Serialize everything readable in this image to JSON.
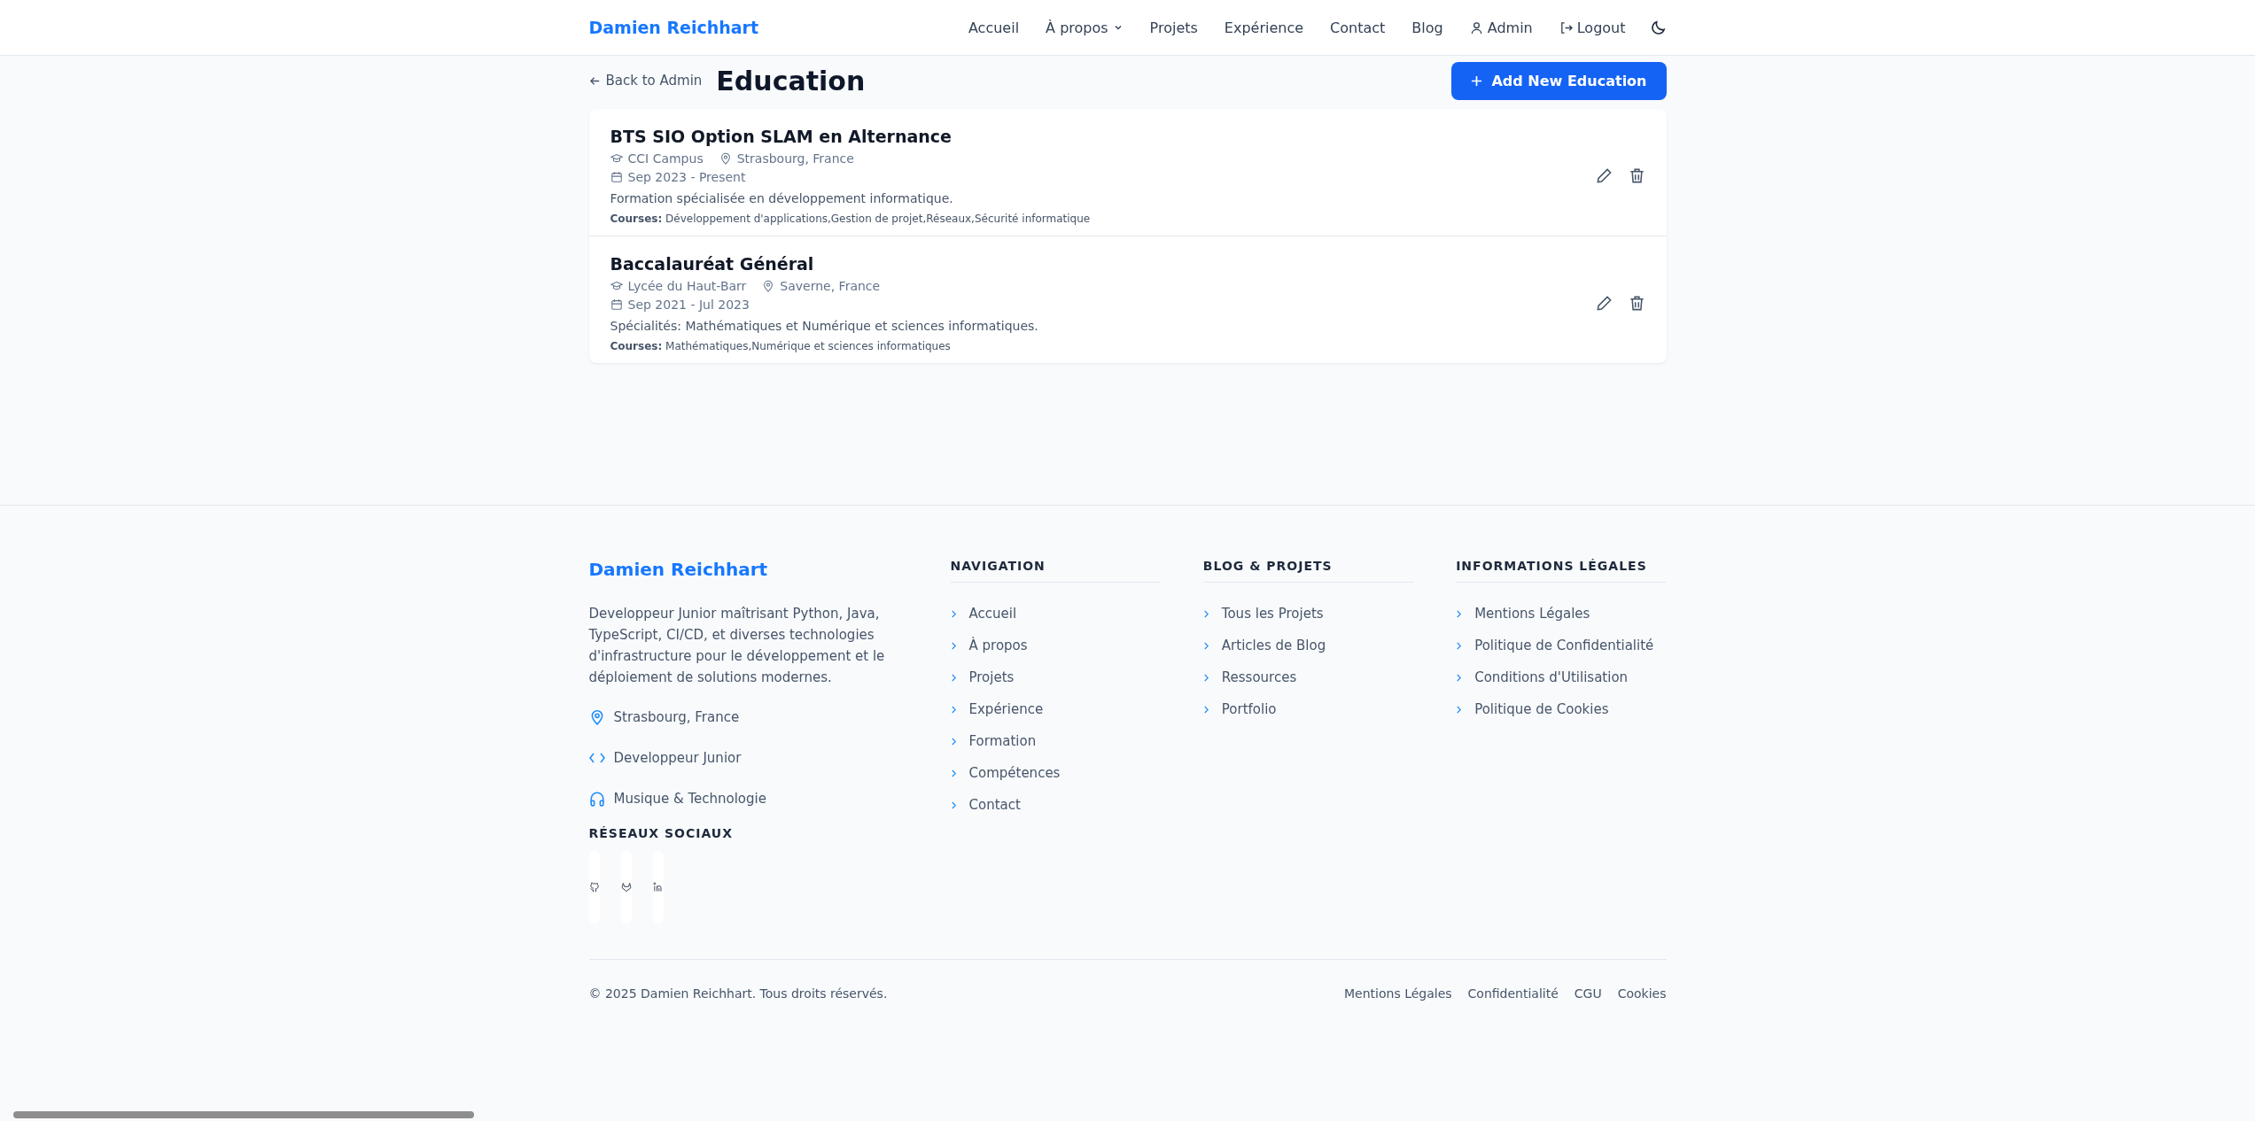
{
  "header": {
    "brand": "Damien Reichhart",
    "nav": [
      {
        "label": "Accueil",
        "dropdown": false
      },
      {
        "label": "À propos",
        "dropdown": true
      },
      {
        "label": "Projets",
        "dropdown": false
      },
      {
        "label": "Expérience",
        "dropdown": false
      },
      {
        "label": "Contact",
        "dropdown": false
      },
      {
        "label": "Blog",
        "dropdown": false
      }
    ],
    "admin": "Admin",
    "logout": "Logout"
  },
  "page": {
    "back": "Back to Admin",
    "title": "Education",
    "add_button": "Add New Education"
  },
  "education": [
    {
      "title": "BTS SIO Option SLAM en Alternance",
      "school": "CCI Campus",
      "location": "Strasbourg, France",
      "dates": "Sep 2023 - Present",
      "description": "Formation spécialisée en développement informatique.",
      "courses_label": "Courses:",
      "courses": "Développement d'applications,Gestion de projet,Réseaux,Sécurité informatique"
    },
    {
      "title": "Baccalauréat Général",
      "school": "Lycée du Haut-Barr",
      "location": "Saverne, France",
      "dates": "Sep 2021 - Jul 2023",
      "description": "Spécialités: Mathématiques et Numérique et sciences informatiques.",
      "courses_label": "Courses:",
      "courses": "Mathématiques,Numérique et sciences informatiques"
    }
  ],
  "footer": {
    "brand": "Damien Reichhart",
    "about": "Developpeur Junior maîtrisant Python, Java, TypeScript, CI/CD, et diverses technologies d'infrastructure pour le développement et le déploiement de solutions modernes.",
    "facts": [
      {
        "kind": "location",
        "text": "Strasbourg, France"
      },
      {
        "kind": "code",
        "text": "Developpeur Junior"
      },
      {
        "kind": "music",
        "text": "Musique & Technologie"
      }
    ],
    "social_heading": "RÉSEAUX SOCIAUX",
    "social": [
      {
        "kind": "github"
      },
      {
        "kind": "gitlab"
      },
      {
        "kind": "linkedin"
      }
    ],
    "columns": [
      {
        "heading": "NAVIGATION",
        "links": [
          "Accueil",
          "À propos",
          "Projets",
          "Expérience",
          "Formation",
          "Compétences",
          "Contact"
        ]
      },
      {
        "heading": "BLOG & PROJETS",
        "links": [
          "Tous les Projets",
          "Articles de Blog",
          "Ressources",
          "Portfolio"
        ]
      },
      {
        "heading": "INFORMATIONS LÉGALES",
        "links": [
          "Mentions Légales",
          "Politique de Confidentialité",
          "Conditions d'Utilisation",
          "Politique de Cookies"
        ]
      }
    ],
    "copyright": "© 2025 Damien Reichhart. Tous droits réservés.",
    "bottom_links": [
      "Mentions Légales",
      "Confidentialité",
      "CGU",
      "Cookies"
    ]
  }
}
